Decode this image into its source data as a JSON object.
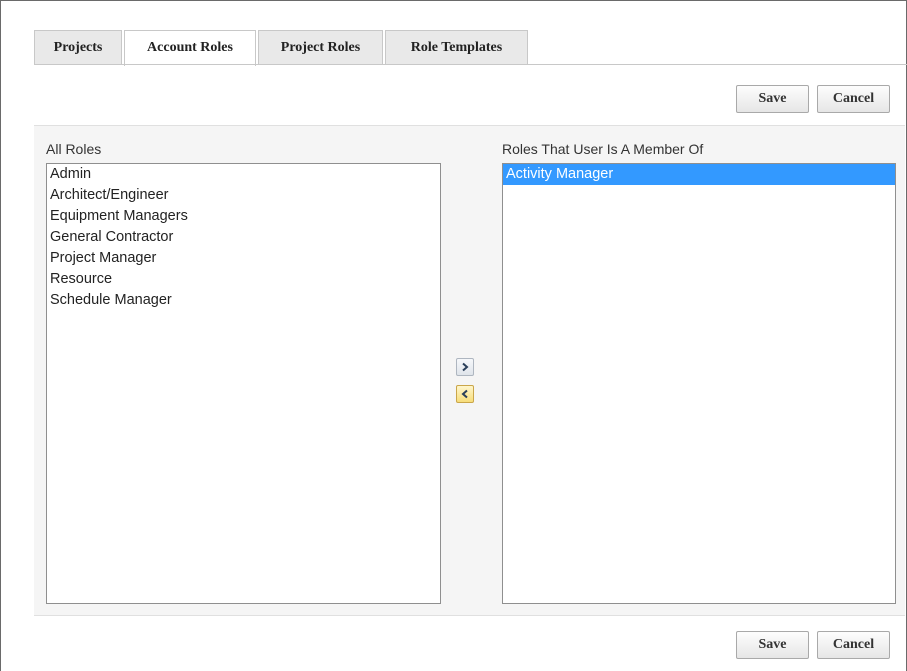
{
  "tabs": [
    {
      "label": "Projects",
      "active": false
    },
    {
      "label": "Account Roles",
      "active": true
    },
    {
      "label": "Project Roles",
      "active": false
    },
    {
      "label": "Role Templates",
      "active": false
    }
  ],
  "toolbar_top": {
    "save_label": "Save",
    "cancel_label": "Cancel"
  },
  "toolbar_bottom": {
    "save_label": "Save",
    "cancel_label": "Cancel"
  },
  "all_roles": {
    "label": "All Roles",
    "items": [
      "Admin",
      "Architect/Engineer",
      "Equipment Managers",
      "General Contractor",
      "Project Manager",
      "Resource",
      "Schedule Manager"
    ]
  },
  "member_roles": {
    "label": "Roles That User Is A Member Of",
    "items": [
      "Activity Manager"
    ],
    "selected": "Activity Manager"
  },
  "move_buttons": {
    "add_icon": "chevron-right-icon",
    "remove_icon": "chevron-left-icon"
  },
  "colors": {
    "selection": "#3399ff",
    "highlight_button": "#f7dd7a"
  }
}
